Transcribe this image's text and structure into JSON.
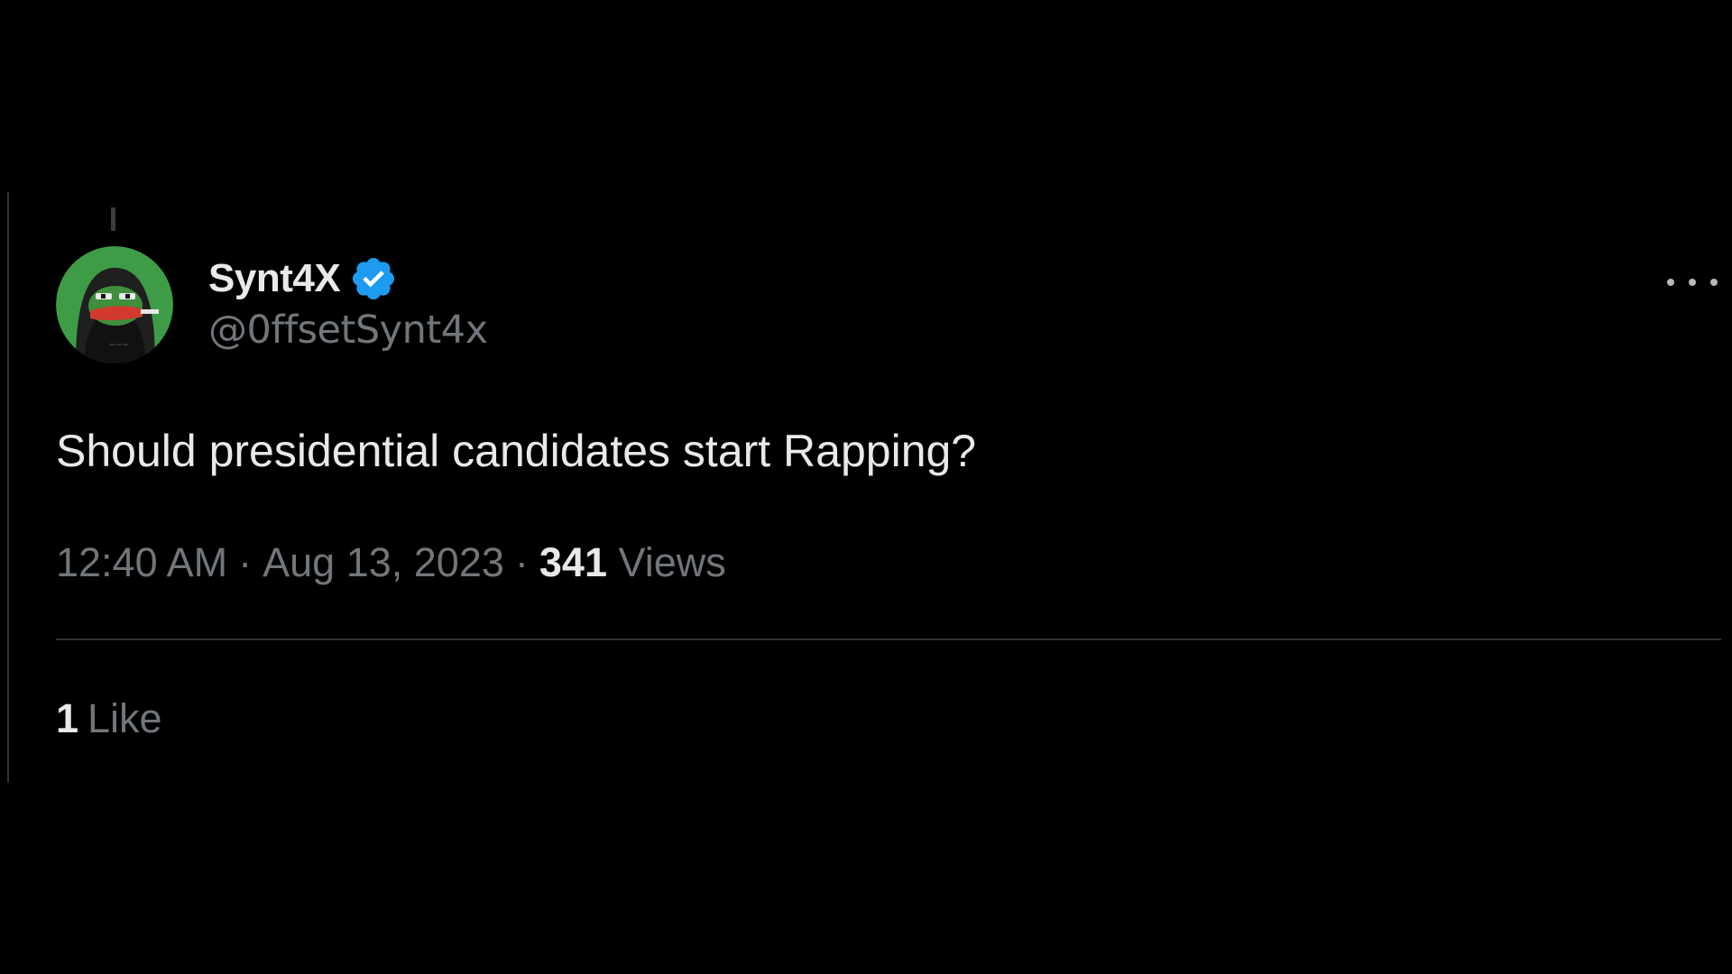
{
  "tweet": {
    "author": {
      "name": "Synt4X",
      "handle": "@0ffsetSynt4x",
      "verified": true,
      "avatar_icon": "hooded-pepe-frog-avatar",
      "avatar_bg_color": "#3e9c47"
    },
    "text": "Should presidential candidates start Rapping?",
    "time": "12:40 AM",
    "date": "Aug 13, 2023",
    "separator": "·",
    "views_count": "341",
    "views_label": "Views",
    "likes_count": "1",
    "likes_label": "Like",
    "more_icon": "more-horizontal-icon",
    "verified_icon": "verified-badge-icon"
  },
  "colors": {
    "background": "#000000",
    "primary_text": "#e7e9ea",
    "secondary_text": "#71767b",
    "divider": "#2f3336",
    "verified_blue": "#1d9bf0"
  }
}
